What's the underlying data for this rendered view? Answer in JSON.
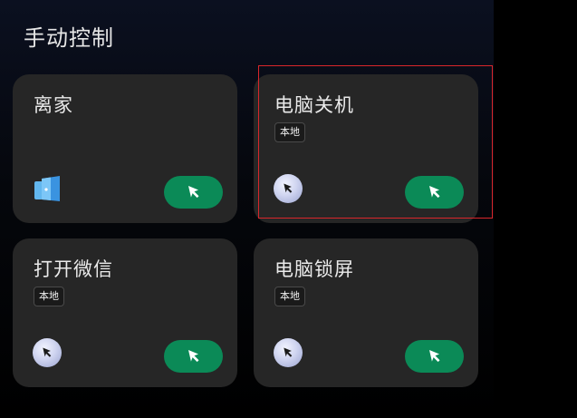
{
  "page": {
    "title": "手动控制"
  },
  "colors": {
    "card_bg": "#262626",
    "run_button": "#0b8a57",
    "highlight": "#d9262b"
  },
  "cards": [
    {
      "title": "离家",
      "badge": "",
      "icon": "door-icon",
      "run_icon": "cursor-arrow-icon"
    },
    {
      "title": "电脑关机",
      "badge": "本地",
      "icon": "cursor-circle-icon",
      "run_icon": "cursor-arrow-icon",
      "highlighted": true
    },
    {
      "title": "打开微信",
      "badge": "本地",
      "icon": "cursor-circle-icon",
      "run_icon": "cursor-arrow-icon"
    },
    {
      "title": "电脑锁屏",
      "badge": "本地",
      "icon": "cursor-circle-icon",
      "run_icon": "cursor-arrow-icon"
    }
  ]
}
